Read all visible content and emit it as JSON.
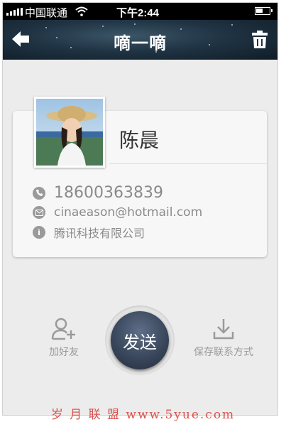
{
  "status_bar": {
    "carrier": "中国联通",
    "time": "下午2:44"
  },
  "nav": {
    "title": "嘀一嘀",
    "back_icon": "back-arrow-icon",
    "trash_icon": "trash-icon"
  },
  "contact": {
    "name": "陈晨",
    "phone": "18600363839",
    "email": "cinaeason@hotmail.com",
    "company": "腾讯科技有限公司"
  },
  "actions": {
    "add_friend_label": "加好友",
    "send_label": "发送",
    "save_contact_label": "保存联系方式"
  },
  "watermark": "岁 月 联 盟  www.5yue.com",
  "colors": {
    "nav_bg": "#203444",
    "send_button": "#3a475c",
    "background": "#ececec",
    "watermark": "#d9534f"
  }
}
